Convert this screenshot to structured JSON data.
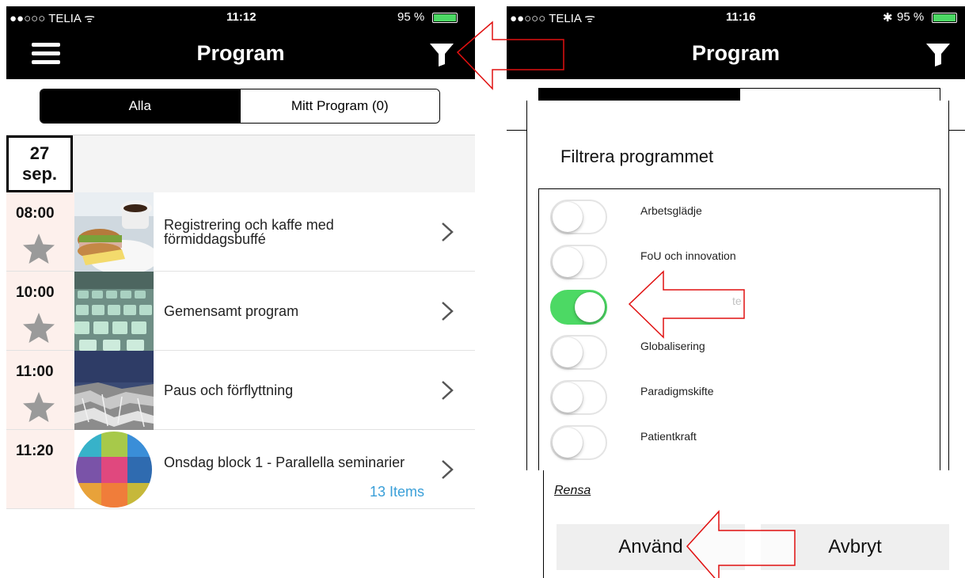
{
  "left_screen": {
    "status": {
      "carrier": "●●○○○ TELIA ᯤ",
      "time": "11:12",
      "battery": "95 %",
      "battery_level": 0.95
    },
    "nav": {
      "title": "Program"
    },
    "tabs": [
      {
        "label": "Alla",
        "active": true
      },
      {
        "label": "Mitt Program (0)",
        "active": false
      }
    ],
    "date": {
      "day": "27",
      "month": "sep."
    },
    "items": [
      {
        "time": "08:00",
        "title": "Registrering och kaffe med förmiddagsbuffé",
        "starred": false,
        "image": "breakfast-photo"
      },
      {
        "time": "10:00",
        "title": "Gemensamt program",
        "starred": false,
        "image": "auditorium-seats-photo"
      },
      {
        "time": "11:00",
        "title": "Paus och förflyttning",
        "starred": false,
        "image": "crumpled-foil-photo"
      },
      {
        "time": "11:20",
        "title": "Onsdag block 1 - Parallella seminarier",
        "count": "13 Items",
        "image": "color-grid-circle"
      }
    ]
  },
  "right_screen": {
    "status": {
      "carrier": "●●○○○ TELIA ᯤ",
      "time": "11:16",
      "battery": "95 %",
      "battery_level": 0.95
    },
    "nav": {
      "title": "Program"
    },
    "dialog": {
      "title": "Filtrera programmet",
      "filters": [
        {
          "label": "Arbetsglädje",
          "on": false
        },
        {
          "label": "FoU och innovation",
          "on": false
        },
        {
          "label": "te",
          "on": true
        },
        {
          "label": "Globalisering",
          "on": false
        },
        {
          "label": "Paradigmskifte",
          "on": false
        },
        {
          "label": "Patientkraft",
          "on": false
        }
      ],
      "clear_label": "Rensa",
      "apply_label": "Använd",
      "cancel_label": "Avbryt"
    }
  },
  "colors": {
    "toggle_on": "#4cd964",
    "accent_link": "#3a9fd8",
    "arrow_stroke": "#e01010",
    "bar": "#000000"
  },
  "icons": [
    "menu-icon",
    "filter-icon",
    "star-icon",
    "chevron-right-icon",
    "wifi-icon",
    "bluetooth-icon",
    "battery-icon"
  ]
}
